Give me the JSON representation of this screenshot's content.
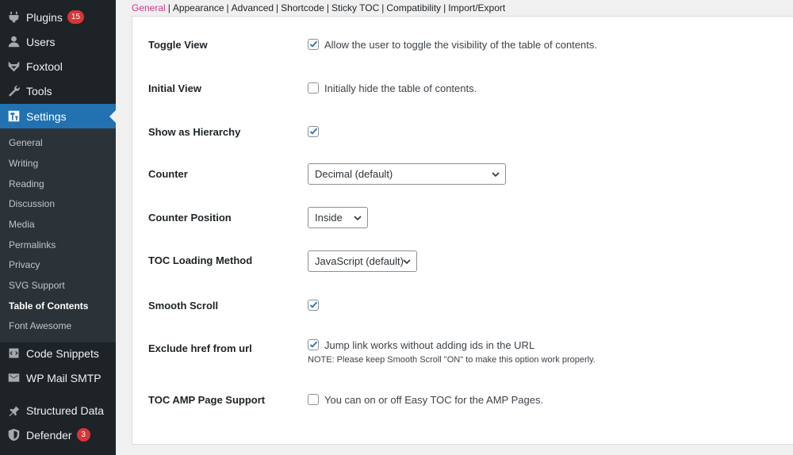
{
  "sidebar": {
    "menu": [
      {
        "label": "Plugins",
        "icon": "plugins-icon",
        "badge": "15"
      },
      {
        "label": "Users",
        "icon": "users-icon"
      },
      {
        "label": "Foxtool",
        "icon": "foxtool-icon"
      },
      {
        "label": "Tools",
        "icon": "wrench-icon"
      },
      {
        "label": "Settings",
        "icon": "settings-icon"
      }
    ],
    "submenu": [
      "General",
      "Writing",
      "Reading",
      "Discussion",
      "Media",
      "Permalinks",
      "Privacy",
      "SVG Support",
      "Table of Contents",
      "Font Awesome"
    ],
    "menu_lower": [
      {
        "label": "Code Snippets",
        "icon": "code-snippets-icon"
      },
      {
        "label": "WP Mail SMTP",
        "icon": "mail-icon"
      },
      {
        "label": "Structured Data",
        "icon": "pin-icon"
      },
      {
        "label": "Defender",
        "icon": "shield-icon",
        "badge": "3"
      }
    ]
  },
  "tabs": [
    "General",
    "Appearance",
    "Advanced",
    "Shortcode",
    "Sticky TOC",
    "Compatibility",
    "Import/Export"
  ],
  "settings": {
    "toggle_view": {
      "label": "Toggle View",
      "checked": true,
      "text": "Allow the user to toggle the visibility of the table of contents."
    },
    "initial_view": {
      "label": "Initial View",
      "checked": false,
      "text": "Initially hide the table of contents."
    },
    "show_hierarchy": {
      "label": "Show as Hierarchy",
      "checked": true
    },
    "counter": {
      "label": "Counter",
      "value": "Decimal (default)"
    },
    "counter_position": {
      "label": "Counter Position",
      "value": "Inside"
    },
    "loading_method": {
      "label": "TOC Loading Method",
      "value": "JavaScript (default)"
    },
    "smooth_scroll": {
      "label": "Smooth Scroll",
      "checked": true
    },
    "exclude_href": {
      "label": "Exclude href from url",
      "checked": true,
      "text": "Jump link works without adding ids in the URL",
      "note": "NOTE: Please keep Smooth Scroll \"ON\" to make this option work properly."
    },
    "amp_support": {
      "label": "TOC AMP Page Support",
      "checked": false,
      "text": "You can on or off Easy TOC for the AMP Pages."
    }
  },
  "colors": {
    "sidebar_bg": "#1d2327",
    "active_bg": "#2271b1",
    "badge_bg": "#d63638",
    "current_tab": "#d3388a",
    "checkmark": "#2271b1"
  }
}
